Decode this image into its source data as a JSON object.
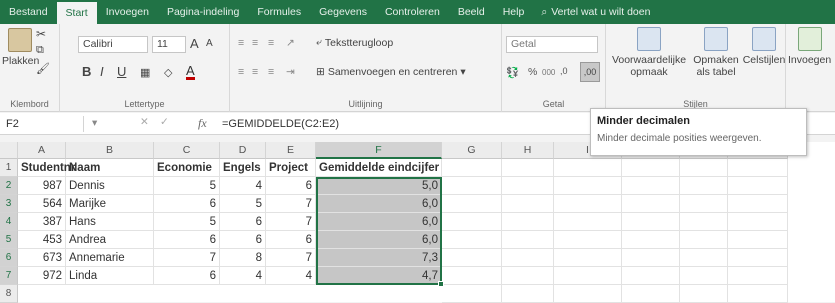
{
  "tabs": [
    "Bestand",
    "Start",
    "Invoegen",
    "Pagina-indeling",
    "Formules",
    "Gegevens",
    "Controleren",
    "Beeld",
    "Help"
  ],
  "tell_me": "Vertel wat u wilt doen",
  "clipboard": {
    "paste": "Plakken",
    "label": "Klembord"
  },
  "font": {
    "name": "Calibri",
    "size": "11",
    "label": "Lettertype",
    "bold": "B",
    "italic": "I",
    "underline": "U",
    "grow": "A",
    "shrink": "A"
  },
  "alignment": {
    "wrap": "Tekstterugloop",
    "merge": "Samenvoegen en centreren",
    "label": "Uitlijning"
  },
  "number": {
    "format": "Getal",
    "percent": "%",
    "thousands": "000",
    "label": "Getal"
  },
  "styles": {
    "conditional": "Voorwaardelijke opmaak",
    "table": "Opmaken als tabel",
    "cell": "Celstijlen",
    "label": "Stijlen"
  },
  "cells": {
    "insert": "Invoegen"
  },
  "formula_bar": {
    "cell_ref": "F2",
    "fx": "fx",
    "content": "=GEMIDDELDE(C2:E2)"
  },
  "tooltip": {
    "title": "Minder decimalen",
    "description": "Minder decimale posities weergeven."
  },
  "columns": [
    "A",
    "B",
    "C",
    "D",
    "E",
    "F",
    "G",
    "H",
    "I",
    "J",
    "K",
    "L"
  ],
  "rows": [
    "1",
    "2",
    "3",
    "4",
    "5",
    "6",
    "7",
    "8"
  ],
  "headers": [
    "Studentnr",
    "Naam",
    "Economie",
    "Engels",
    "Project",
    "Gemiddelde eindcijfer"
  ],
  "data": [
    [
      "987",
      "Dennis",
      "5",
      "4",
      "6",
      "5,0"
    ],
    [
      "564",
      "Marijke",
      "6",
      "5",
      "7",
      "6,0"
    ],
    [
      "387",
      "Hans",
      "5",
      "6",
      "7",
      "6,0"
    ],
    [
      "453",
      "Andrea",
      "6",
      "6",
      "6",
      "6,0"
    ],
    [
      "673",
      "Annemarie",
      "7",
      "8",
      "7",
      "7,3"
    ],
    [
      "972",
      "Linda",
      "6",
      "4",
      "4",
      "4,7"
    ]
  ]
}
